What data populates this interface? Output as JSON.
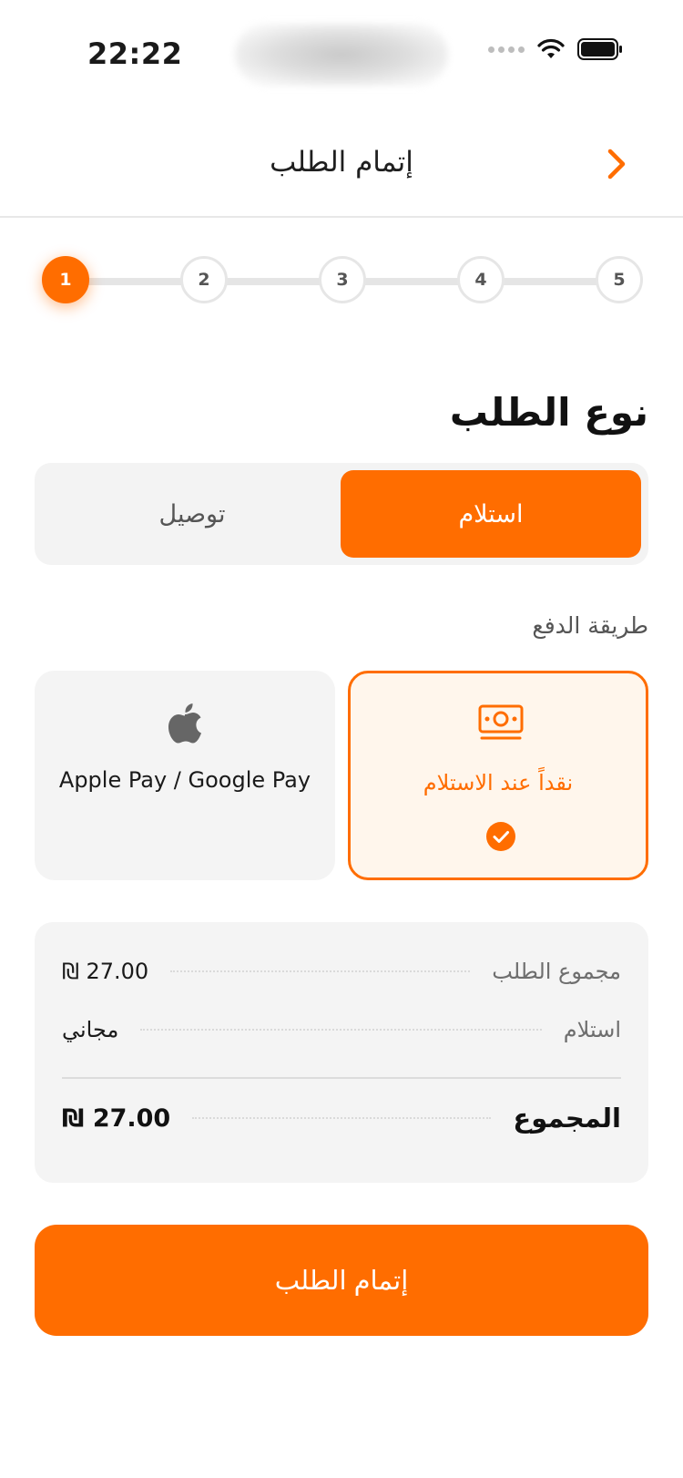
{
  "status_bar": {
    "time": "22:22"
  },
  "header": {
    "title": "إتمام الطلب",
    "back_icon": "chevron-right-icon"
  },
  "stepper": {
    "steps": [
      "1",
      "2",
      "3",
      "4",
      "5"
    ],
    "active_step": 1
  },
  "order_type": {
    "title": "نوع الطلب",
    "options": {
      "pickup": "استلام",
      "delivery": "توصيل"
    },
    "selected": "pickup"
  },
  "payment": {
    "label": "طريقة الدفع",
    "options": {
      "cash": {
        "label": "نقداً عند الاستلام",
        "icon": "cash-icon"
      },
      "wallet": {
        "label": "Apple Pay / Google Pay",
        "icon": "apple-icon"
      }
    },
    "selected": "cash"
  },
  "summary": {
    "subtotal_label": "مجموع الطلب",
    "subtotal_value": "₪ 27.00",
    "pickup_label": "استلام",
    "pickup_value": "مجاني",
    "total_label": "المجموع",
    "total_value": "₪ 27.00"
  },
  "submit": {
    "label": "إتمام الطلب"
  },
  "colors": {
    "accent": "#ff6d00",
    "accent_light": "#fff6ec",
    "surface": "#f4f4f4"
  }
}
